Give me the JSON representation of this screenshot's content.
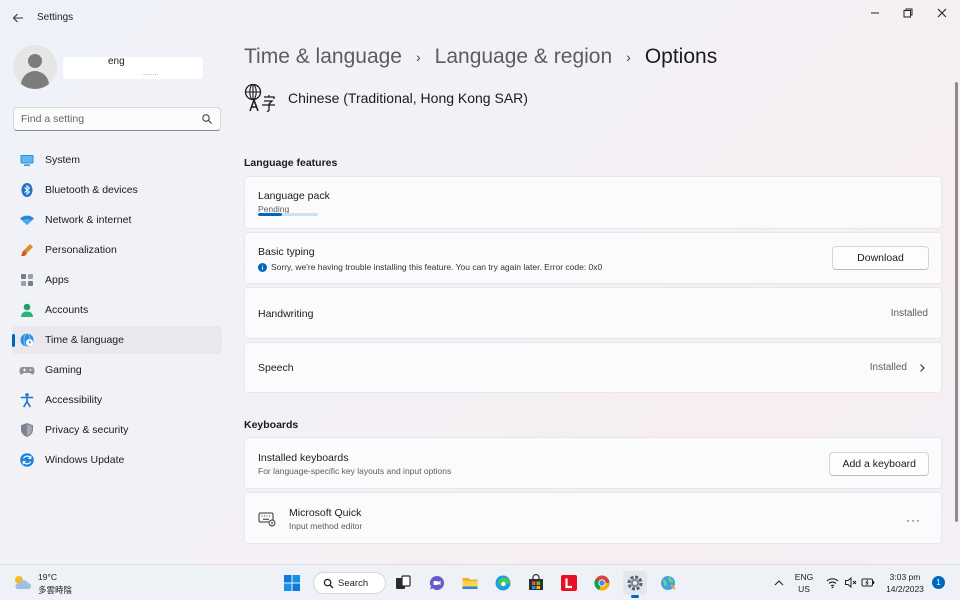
{
  "window": {
    "title": "Settings"
  },
  "profile": {
    "name": "eng",
    "sub": "........"
  },
  "search": {
    "placeholder": "Find a setting"
  },
  "sidebar": {
    "items": [
      {
        "label": "System",
        "icon": "monitor-icon"
      },
      {
        "label": "Bluetooth & devices",
        "icon": "bluetooth-icon"
      },
      {
        "label": "Network & internet",
        "icon": "wifi-icon"
      },
      {
        "label": "Personalization",
        "icon": "brush-icon"
      },
      {
        "label": "Apps",
        "icon": "apps-icon"
      },
      {
        "label": "Accounts",
        "icon": "person-icon"
      },
      {
        "label": "Time & language",
        "icon": "globe-clock-icon",
        "active": true
      },
      {
        "label": "Gaming",
        "icon": "controller-icon"
      },
      {
        "label": "Accessibility",
        "icon": "accessibility-icon"
      },
      {
        "label": "Privacy & security",
        "icon": "shield-icon"
      },
      {
        "label": "Windows Update",
        "icon": "update-icon"
      }
    ]
  },
  "breadcrumb": {
    "level1": "Time & language",
    "level2": "Language & region",
    "current": "Options",
    "separator": "›"
  },
  "language": {
    "name": "Chinese (Traditional, Hong Kong SAR)",
    "icon": "language-icon"
  },
  "features": {
    "section_title": "Language features",
    "language_pack": {
      "title": "Language pack",
      "status": "Pending",
      "progress": 0.4
    },
    "basic_typing": {
      "title": "Basic typing",
      "error": "Sorry, we're having trouble installing this feature. You can try again later. Error code: 0x0",
      "button": "Download"
    },
    "handwriting": {
      "title": "Handwriting",
      "status": "Installed"
    },
    "speech": {
      "title": "Speech",
      "status": "Installed"
    }
  },
  "keyboards": {
    "section_title": "Keyboards",
    "installed": {
      "title": "Installed keyboards",
      "subtitle": "For language-specific key layouts and input options",
      "button": "Add a keyboard"
    },
    "quick": {
      "title": "Microsoft Quick",
      "subtitle": "Input method editor",
      "more": "···"
    }
  },
  "taskbar": {
    "weather_temp": "19°C",
    "weather_cond": "多雲時陰",
    "search_label": "Search",
    "lang_top": "ENG",
    "lang_bottom": "US",
    "time": "3:03 pm",
    "date": "14/2/2023",
    "notifications": "1"
  },
  "colors": {
    "accent": "#0067c0",
    "office_red": "#e81123"
  }
}
